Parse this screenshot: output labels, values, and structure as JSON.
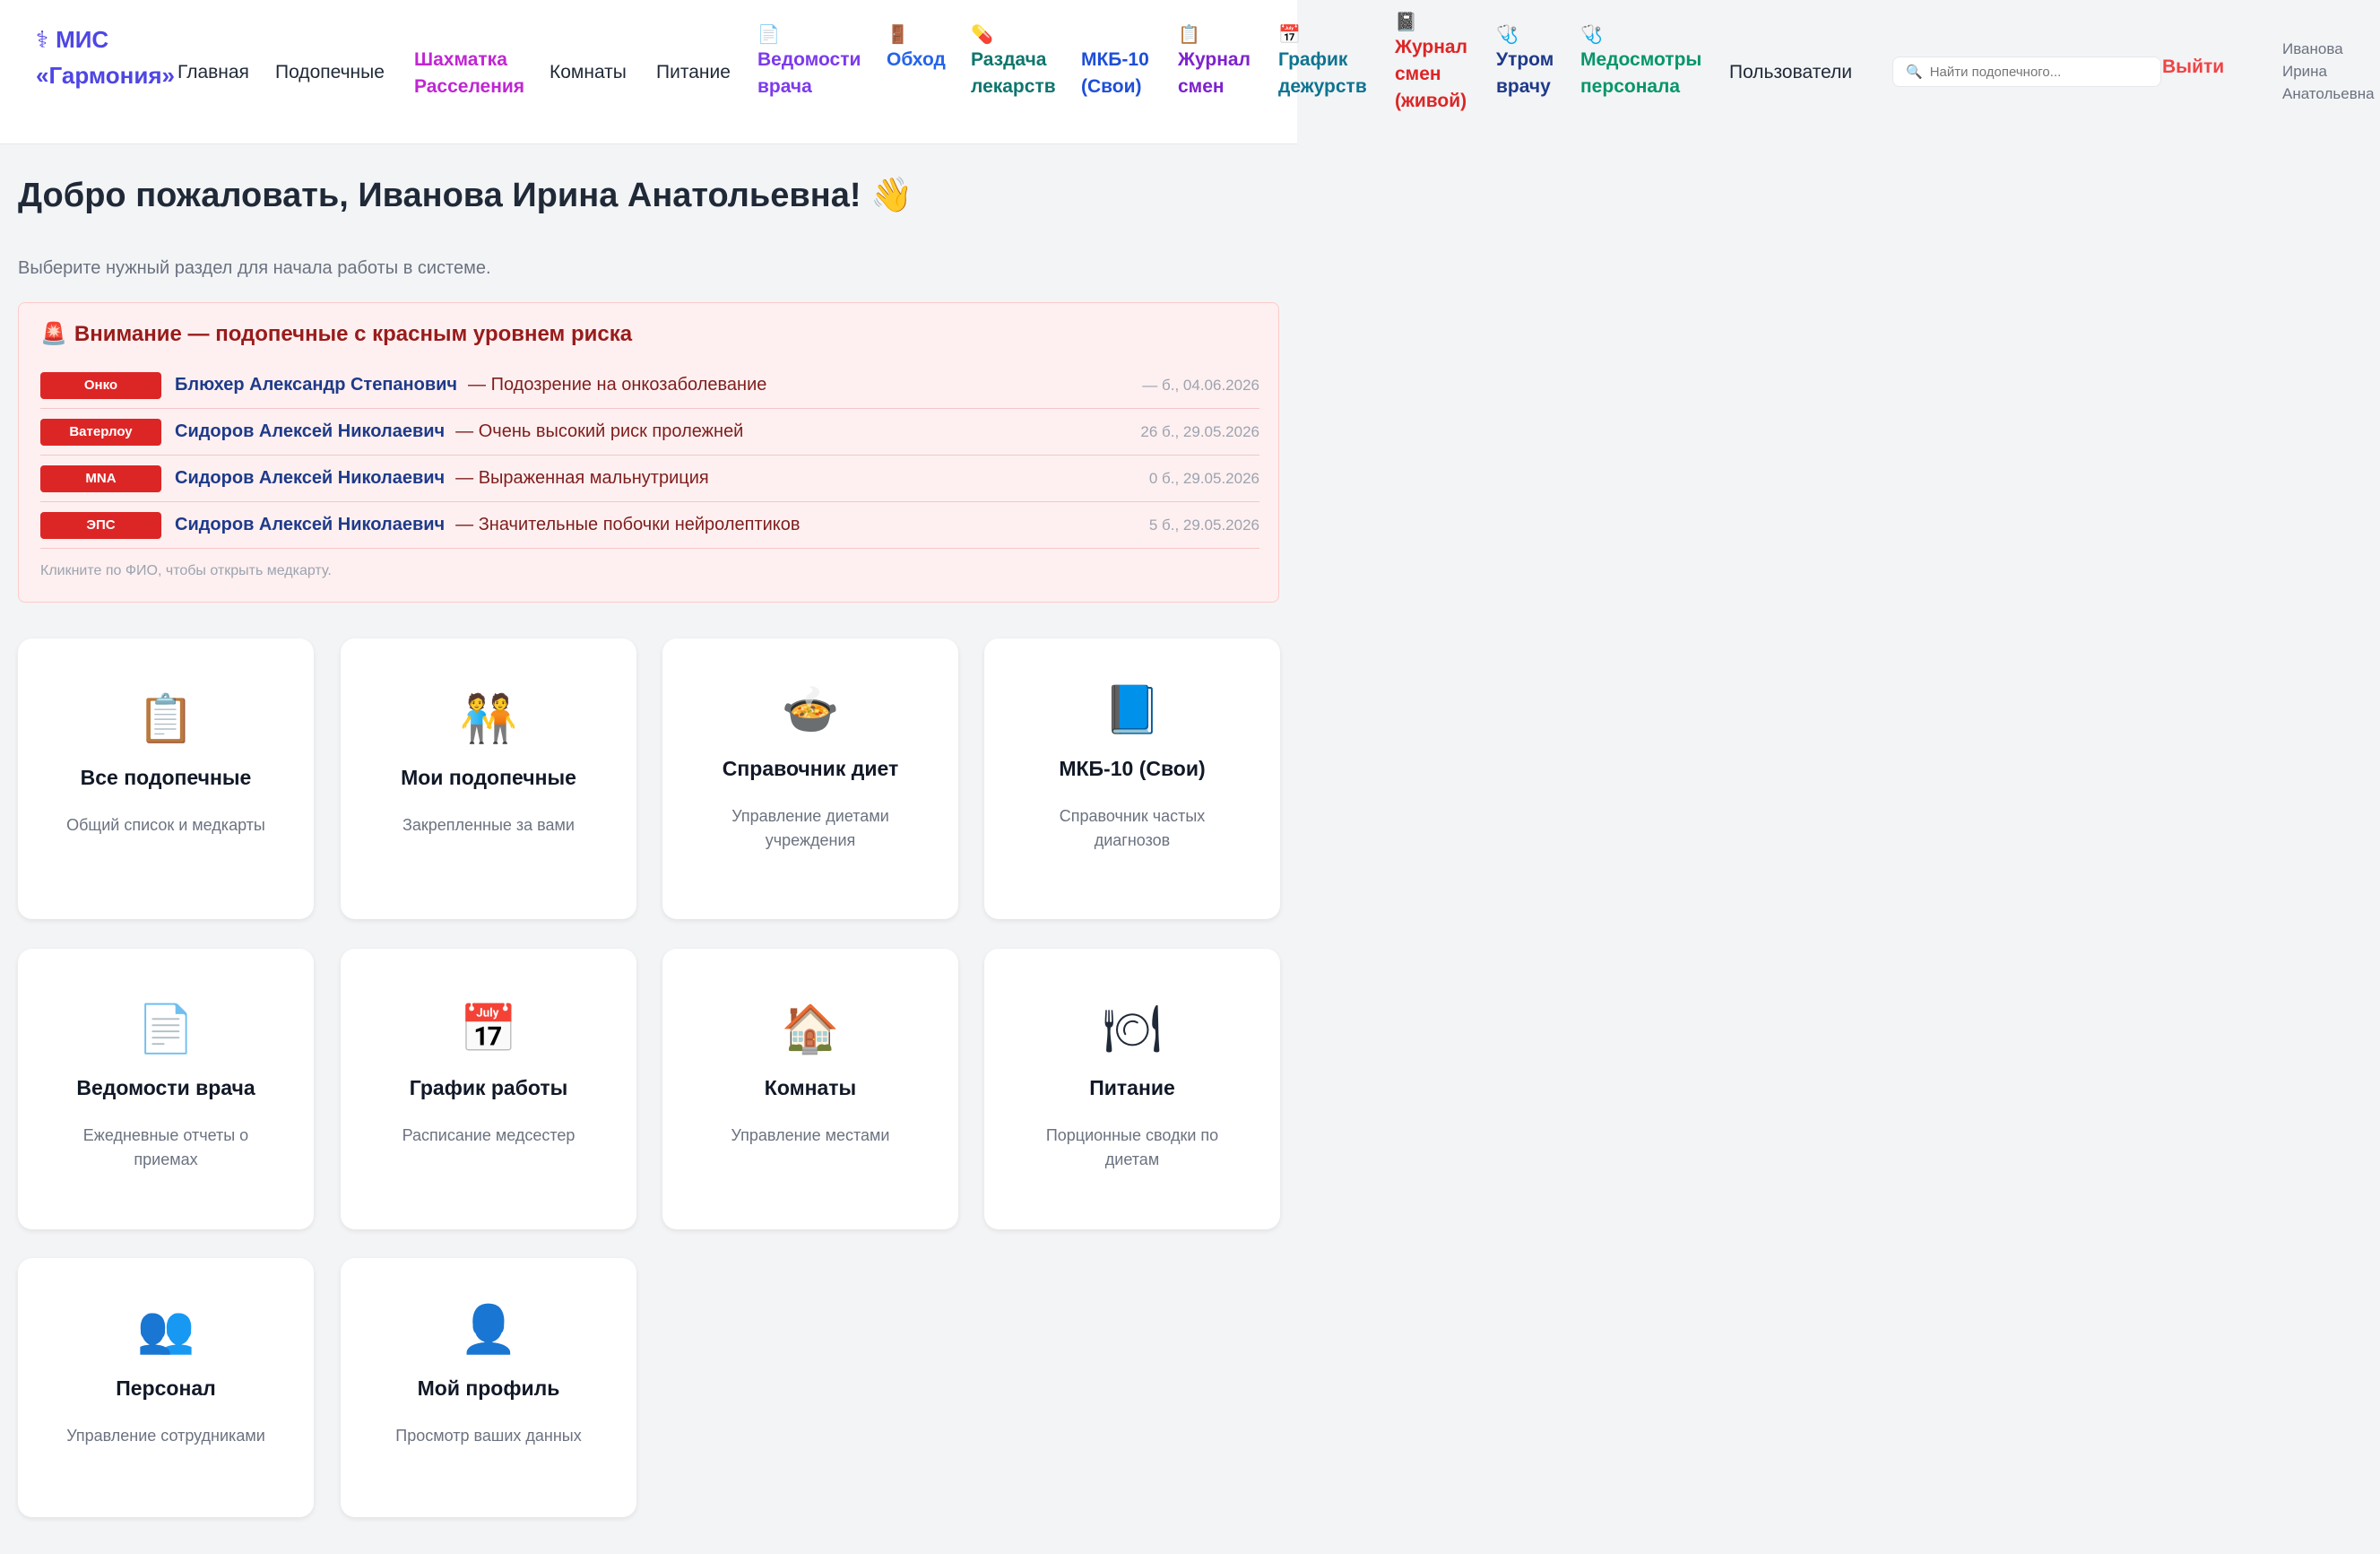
{
  "app": {
    "title_line1": "МИС",
    "title_line2": "«Гармония»",
    "logo_icon": "⚕"
  },
  "nav": [
    {
      "label": "Главная",
      "color": "#1f2937"
    },
    {
      "label": "Подопечные",
      "color": "#1f2937"
    },
    {
      "label": "Шахматка\nРасселения",
      "color": "#c026d3"
    },
    {
      "label": "Комнаты",
      "color": "#1f2937"
    },
    {
      "label": "Питание",
      "color": "#1f2937"
    },
    {
      "label": "Ведомости\nврача",
      "color": "#7c3aed",
      "icon": "📄"
    },
    {
      "label": "Обход",
      "color": "#2563eb",
      "icon": "🚪"
    },
    {
      "label": "Раздача\nлекарств",
      "color": "#0f766e",
      "icon": "💊"
    },
    {
      "label": "МКБ-10\n(Свои)",
      "color": "#1d4ed8"
    },
    {
      "label": "Журнал\nсмен",
      "color": "#7e22ce",
      "icon": "📋"
    },
    {
      "label": "График\nдежурств",
      "color": "#0e7490",
      "icon": "📅"
    },
    {
      "label": "Журнал\nсмен\n(живой)",
      "color": "#dc2626",
      "icon": "📓"
    },
    {
      "label": "Утром\nврачу",
      "color": "#1e3a8a",
      "icon": "🩺"
    },
    {
      "label": "Медосмотры\nперсонала",
      "color": "#059669",
      "icon": "🩺"
    },
    {
      "label": "Пользователи",
      "color": "#1f2937"
    }
  ],
  "search": {
    "placeholder": "Найти подопечного...",
    "icon": "🔍"
  },
  "logout_label": "Выйти",
  "user_name": "Иванова\nИрина\nАнатольевна",
  "welcome": "Добро пожаловать, Иванова Ирина Анатольевна! 👋",
  "subtitle": "Выберите нужный раздел для начала работы в системе.",
  "alert": {
    "icon": "🚨",
    "title": "Внимание — подопечные с красным уровнем риска",
    "rows": [
      {
        "badge": "Онко",
        "name": "Блюхер Александр Степанович",
        "desc": "— Подозрение на онкозаболевание",
        "date": "— б., 04.06.2026"
      },
      {
        "badge": "Ватерлоу",
        "name": "Сидоров Алексей Николаевич",
        "desc": "— Очень высокий риск пролежней",
        "date": "26 б., 29.05.2026"
      },
      {
        "badge": "MNA",
        "name": "Сидоров Алексей Николаевич",
        "desc": "— Выраженная мальнутриция",
        "date": "0 б., 29.05.2026"
      },
      {
        "badge": "ЭПС",
        "name": "Сидоров Алексей Николаевич",
        "desc": "— Значительные побочки нейролептиков",
        "date": "5 б., 29.05.2026"
      }
    ],
    "hint": "Кликните по ФИО, чтобы открыть медкарту."
  },
  "cards": [
    {
      "icon": "📋",
      "title": "Все подопечные",
      "desc": "Общий список и медкарты"
    },
    {
      "icon": "🧑‍🤝‍🧑",
      "title": "Мои подопечные",
      "desc": "Закрепленные за вами"
    },
    {
      "icon": "🍲",
      "title": "Справочник диет",
      "desc": "Управление диетами учреждения"
    },
    {
      "icon": "📘",
      "title": "МКБ-10 (Свои)",
      "desc": "Справочник частых диагнозов"
    },
    {
      "icon": "📄",
      "title": "Ведомости врача",
      "desc": "Ежедневные отчеты о приемах"
    },
    {
      "icon": "📅",
      "title": "График работы",
      "desc": "Расписание медсестер"
    },
    {
      "icon": "🏠",
      "title": "Комнаты",
      "desc": "Управление местами"
    },
    {
      "icon": "🍽",
      "title": "Питание",
      "desc": "Порционные сводки по диетам"
    },
    {
      "icon": "👥",
      "title": "Персонал",
      "desc": "Управление сотрудниками"
    },
    {
      "icon": "👤",
      "title": "Мой профиль",
      "desc": "Просмотр ваших данных"
    }
  ]
}
